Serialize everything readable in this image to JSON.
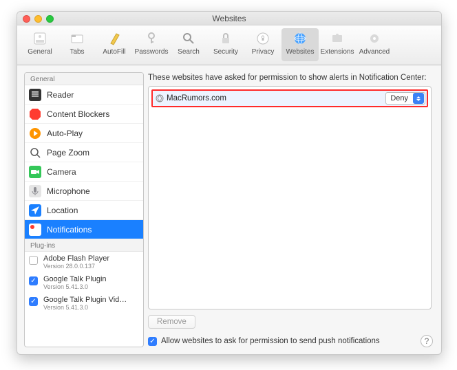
{
  "window": {
    "title": "Websites"
  },
  "toolbar": {
    "items": [
      {
        "label": "General"
      },
      {
        "label": "Tabs"
      },
      {
        "label": "AutoFill"
      },
      {
        "label": "Passwords"
      },
      {
        "label": "Search"
      },
      {
        "label": "Security"
      },
      {
        "label": "Privacy"
      },
      {
        "label": "Websites"
      },
      {
        "label": "Extensions"
      },
      {
        "label": "Advanced"
      }
    ]
  },
  "sidebar": {
    "section_general": "General",
    "items": [
      {
        "label": "Reader"
      },
      {
        "label": "Content Blockers"
      },
      {
        "label": "Auto-Play"
      },
      {
        "label": "Page Zoom"
      },
      {
        "label": "Camera"
      },
      {
        "label": "Microphone"
      },
      {
        "label": "Location"
      },
      {
        "label": "Notifications"
      }
    ],
    "section_plugins": "Plug-ins",
    "plugins": [
      {
        "name": "Adobe Flash Player",
        "version": "Version 28.0.0.137",
        "enabled": false
      },
      {
        "name": "Google Talk Plugin",
        "version": "Version 5.41.3.0",
        "enabled": true
      },
      {
        "name": "Google Talk Plugin Vid…",
        "version": "Version 5.41.3.0",
        "enabled": true
      }
    ]
  },
  "main": {
    "description": "These websites have asked for permission to show alerts in Notification Center:",
    "rows": [
      {
        "site": "MacRumors.com",
        "permission": "Deny"
      }
    ],
    "remove_label": "Remove",
    "allow_checkbox_label": "Allow websites to ask for permission to send push notifications",
    "allow_checked": true
  },
  "help_label": "?"
}
